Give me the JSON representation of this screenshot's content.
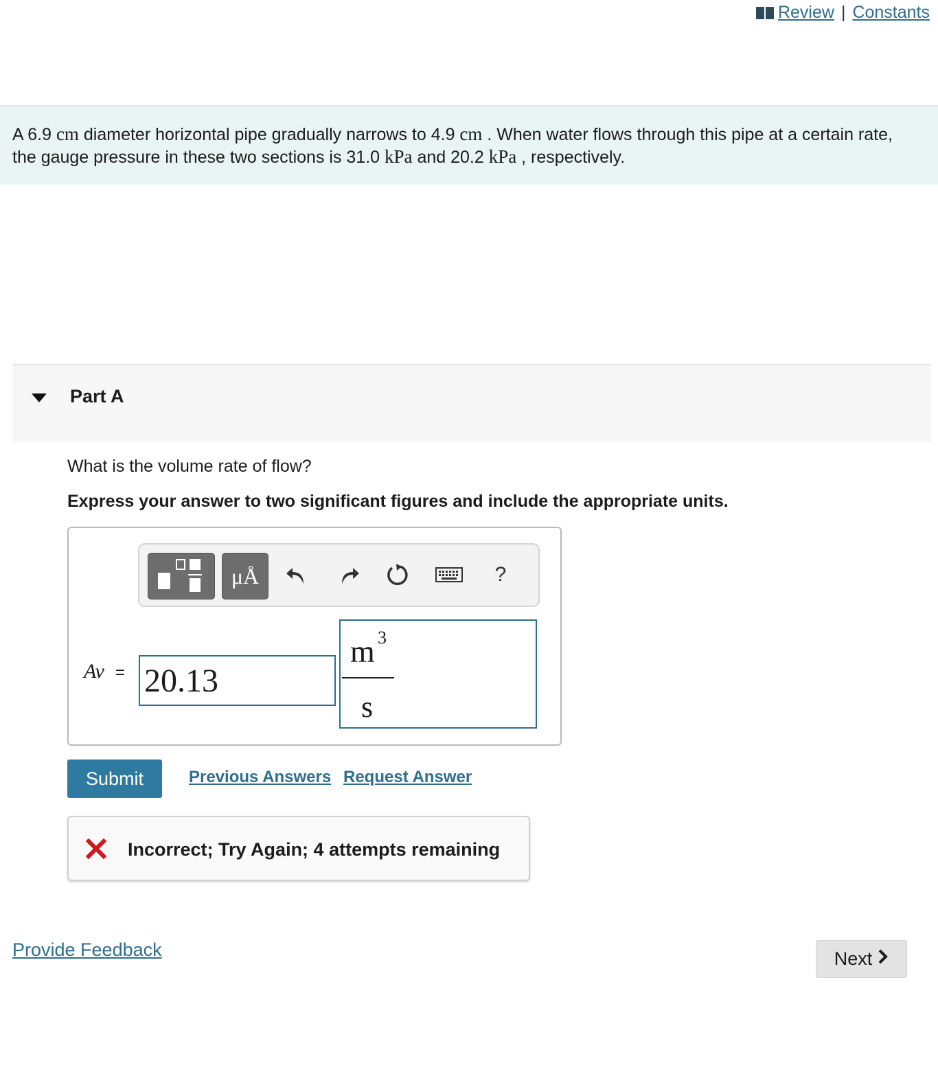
{
  "header": {
    "review_label": "Review",
    "separator": "|",
    "constants_label": "Constants"
  },
  "problem": {
    "p1": "A 6.9 ",
    "u1": "cm",
    "p2": " diameter horizontal pipe gradually narrows to 4.9 ",
    "u2": "cm",
    "p3": " . When water flows through this pipe at a certain rate,",
    "p4": "the gauge pressure in these two sections is 31.0 ",
    "u3": "kPa",
    "p5": " and 20.2 ",
    "u4": "kPa",
    "p6": " , respectively."
  },
  "part": {
    "title": "Part A",
    "question": "What is the volume rate of flow?",
    "instruction": "Express your answer to two significant figures and include the appropriate units."
  },
  "toolbar": {
    "units_button": "μÅ",
    "help_button": "?"
  },
  "answer": {
    "variable": "Av",
    "equals": "=",
    "value": "20.13",
    "unit_numerator": "m",
    "unit_exponent": "3",
    "unit_denominator": "s"
  },
  "actions": {
    "submit": "Submit",
    "previous_answers": "Previous Answers",
    "request_answer": "Request Answer"
  },
  "feedback": {
    "message": "Incorrect; Try Again; 4 attempts remaining",
    "status_color": "#d0191f"
  },
  "footer": {
    "provide_feedback": "Provide Feedback",
    "next": "Next"
  }
}
